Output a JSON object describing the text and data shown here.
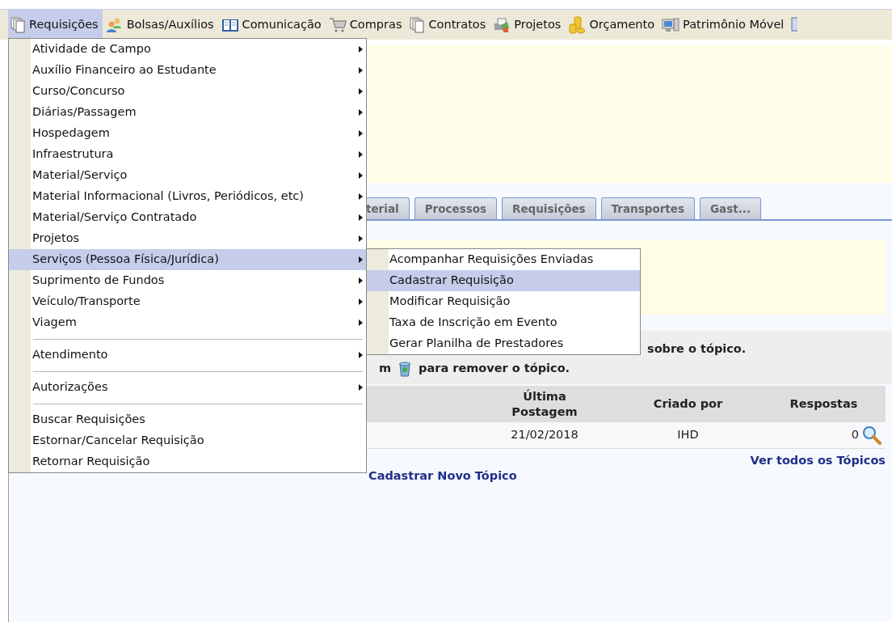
{
  "menubar": [
    {
      "label": "Requisições",
      "selected": true
    },
    {
      "label": "Bolsas/Auxílios",
      "selected": false
    },
    {
      "label": "Comunicação",
      "selected": false
    },
    {
      "label": "Compras",
      "selected": false
    },
    {
      "label": "Contratos",
      "selected": false
    },
    {
      "label": "Projetos",
      "selected": false
    },
    {
      "label": "Orçamento",
      "selected": false
    },
    {
      "label": "Patrimônio Móvel",
      "selected": false
    }
  ],
  "menu": [
    {
      "kind": "item",
      "label": "Atividade de Campo",
      "submenu": true,
      "selected": false
    },
    {
      "kind": "item",
      "label": "Auxílio Financeiro ao Estudante",
      "submenu": true,
      "selected": false
    },
    {
      "kind": "item",
      "label": "Curso/Concurso",
      "submenu": true,
      "selected": false
    },
    {
      "kind": "item",
      "label": "Diárias/Passagem",
      "submenu": true,
      "selected": false
    },
    {
      "kind": "item",
      "label": "Hospedagem",
      "submenu": true,
      "selected": false
    },
    {
      "kind": "item",
      "label": "Infraestrutura",
      "submenu": true,
      "selected": false
    },
    {
      "kind": "item",
      "label": "Material/Serviço",
      "submenu": true,
      "selected": false
    },
    {
      "kind": "item",
      "label": "Material Informacional (Livros, Periódicos, etc)",
      "submenu": true,
      "selected": false
    },
    {
      "kind": "item",
      "label": "Material/Serviço Contratado",
      "submenu": true,
      "selected": false
    },
    {
      "kind": "item",
      "label": "Projetos",
      "submenu": true,
      "selected": false
    },
    {
      "kind": "item",
      "label": "Serviços (Pessoa Física/Jurídica)",
      "submenu": true,
      "selected": true
    },
    {
      "kind": "item",
      "label": "Suprimento de Fundos",
      "submenu": true,
      "selected": false
    },
    {
      "kind": "item",
      "label": "Veículo/Transporte",
      "submenu": true,
      "selected": false
    },
    {
      "kind": "item",
      "label": "Viagem",
      "submenu": true,
      "selected": false
    },
    {
      "kind": "separator"
    },
    {
      "kind": "item",
      "label": "Atendimento",
      "submenu": true,
      "selected": false
    },
    {
      "kind": "separator"
    },
    {
      "kind": "item",
      "label": "Autorizações",
      "submenu": true,
      "selected": false
    },
    {
      "kind": "separator"
    },
    {
      "kind": "item",
      "label": "Buscar Requisições",
      "submenu": false,
      "selected": false
    },
    {
      "kind": "item",
      "label": "Estornar/Cancelar Requisição",
      "submenu": false,
      "selected": false
    },
    {
      "kind": "item",
      "label": "Retornar Requisição",
      "submenu": false,
      "selected": false
    }
  ],
  "submenu": [
    {
      "label": "Acompanhar Requisições Enviadas",
      "selected": false
    },
    {
      "label": "Cadastrar Requisição",
      "selected": true
    },
    {
      "label": "Modificar Requisição",
      "selected": false
    },
    {
      "label": "Taxa de Inscrição em Evento",
      "selected": false
    },
    {
      "label": "Gerar Planilha de Prestadores",
      "selected": false
    }
  ],
  "tabs": [
    {
      "label": "terial",
      "selected": false
    },
    {
      "label": "Processos",
      "selected": false
    },
    {
      "label": "Requisições",
      "selected": false
    },
    {
      "label": "Transportes",
      "selected": false
    },
    {
      "label": "Gast...",
      "selected": false
    }
  ],
  "instructions": {
    "line_1": "sobre o tópico.",
    "line_2_start": "m",
    "line_2_end": "para remover o tópico."
  },
  "table": {
    "columns": [
      "Última Postagem",
      "Criado por",
      "Respostas"
    ],
    "rows": [
      {
        "cells": [
          "21/02/2018",
          "IHD",
          "0"
        ]
      }
    ]
  },
  "links": {
    "all_topics": "Ver todos os Tópicos",
    "new_topic": "Cadastrar Novo Tópico"
  }
}
